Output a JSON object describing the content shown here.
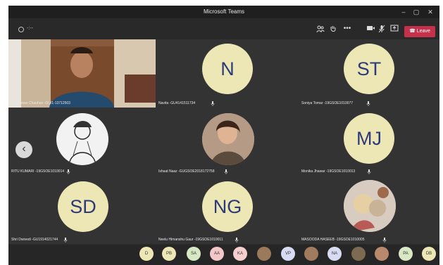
{
  "window": {
    "title": "Microsoft Teams",
    "minimize": "–",
    "maximize": "▢",
    "close": "✕"
  },
  "toolbar": {
    "timer": "-:--",
    "people_icon": "people-icon",
    "raise_hand_icon": "raise-hand-icon",
    "more": "•••",
    "camera_icon": "camera-icon",
    "mic_icon": "mic-off-icon",
    "share_icon": "share-icon",
    "leave_label": "Leave"
  },
  "tiles": [
    {
      "name": "Dr. Suman Chauhan -GU/1-13712503",
      "kind": "video"
    },
    {
      "name": "Navita -GU4141511734",
      "initials": "N",
      "kind": "initials"
    },
    {
      "name": "Soniya Tomar -19GSOE1010077",
      "initials": "ST",
      "kind": "initials"
    },
    {
      "name": "RITU KUMARI -19GSOE1010014",
      "kind": "photo"
    },
    {
      "name": "Ishaat Naaz -GUGSOE2018172758",
      "kind": "photo"
    },
    {
      "name": "Monika Jhawar -19GSOE1010013",
      "initials": "MJ",
      "kind": "initials"
    },
    {
      "name": "Shri Dwivedi -GU1914021744",
      "initials": "SD",
      "kind": "initials"
    },
    {
      "name": "Neelu Himanshu Gaur -19GSOE1010011",
      "initials": "NG",
      "kind": "initials"
    },
    {
      "name": "MASOODA HASEEB -19GSOE1010005",
      "kind": "photo"
    }
  ],
  "strip": [
    "D",
    "PB",
    "SA",
    "AA",
    "KA",
    "",
    "VP",
    "",
    "NA",
    "",
    "",
    "PA",
    "DB"
  ],
  "colors": {
    "avatar": "#ece7b4",
    "avatar_text": "#2d3a7a",
    "leave": "#c4314b"
  }
}
